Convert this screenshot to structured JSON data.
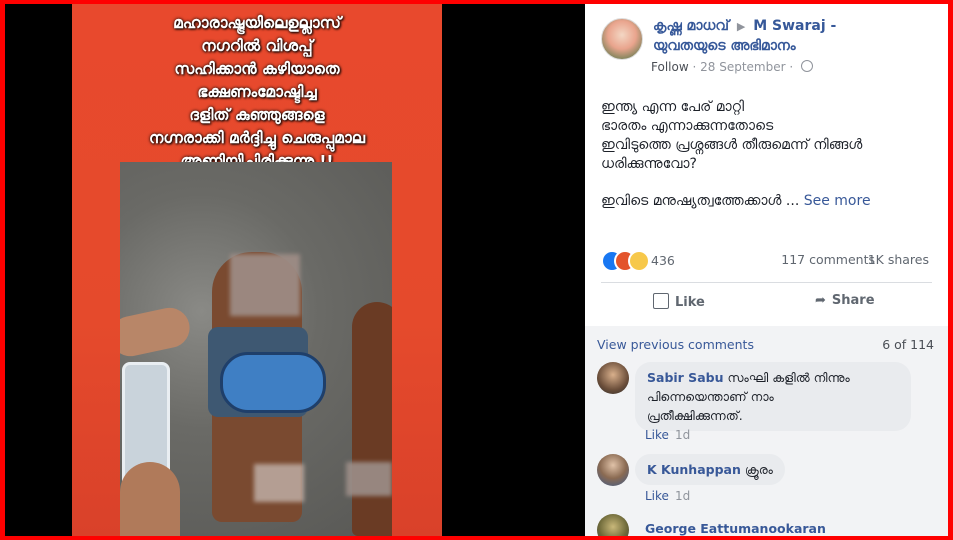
{
  "poster": {
    "lines": [
      "മഹാരാഷ്ട്രയിലെഉല്ലാസ്",
      "നഗറിൽ വിശപ്പ്",
      "സഹിക്കാൻ കഴിയാതെ",
      "ഭക്ഷണംമോഷ്ടിച്ച",
      "ദളിത് കുഞ്ഞുങ്ങളെ",
      "നഗ്നരാക്കി മർദ്ദിച്ചു ചെരുപ്പുമാല",
      "അണിയിച്ചിരിക്കുന്നു !!"
    ]
  },
  "post": {
    "author": "കൃഷ്ണ മാധവ്",
    "arrow": "▶",
    "group": "M Swaraj -",
    "group_line2": "യുവതയുടെ അഭിമാനം",
    "follow": "Follow",
    "separator": "·",
    "date": "28 September",
    "body_p1": [
      "ഇന്ത്യ എന്ന പേര് മാറ്റി",
      "ഭാരതം എന്നാക്കുന്നതോടെ",
      "ഇവിടുത്തെ പ്രശ്നങ്ങൾ തീരുമെന്ന് നിങ്ങൾ",
      "ധരിക്കുന്നുവോ?"
    ],
    "body_p2": "ഇവിടെ മനുഷ്യത്വത്തേക്കാൾ ...",
    "see_more": "See more",
    "reaction_count": "436",
    "comments_count": "117 comments",
    "shares_count": "1K shares",
    "like_label": "Like",
    "share_label": "Share"
  },
  "comments": {
    "view_previous": "View previous comments",
    "count": "6 of 114",
    "items": [
      {
        "name": "Sabir Sabu",
        "text_line1": " സംഘി കളിൽ നിന്നും",
        "text_line2": "പിന്നെയെന്താണ് നാം",
        "text_line3": "പ്രതീക്ഷിക്കുന്നത്.",
        "like": "Like",
        "time": "1d"
      },
      {
        "name": "K Kunhappan",
        "text_line1": " ക്രൂരം",
        "like": "Like",
        "time": "1d"
      },
      {
        "name": "George Eattumanookaran"
      }
    ]
  },
  "colors": {
    "accent": "#365899",
    "frame": "#ff0000",
    "poster_bg": "#e54a2c"
  }
}
